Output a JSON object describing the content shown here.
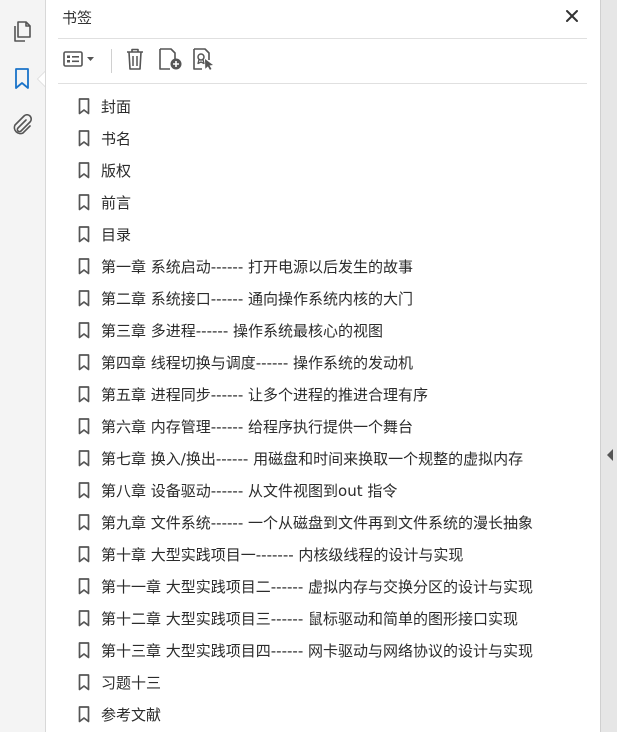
{
  "panel": {
    "title": "书签"
  },
  "icons": {
    "pages": "pages-icon",
    "bookmarks": "bookmark-icon",
    "attachments": "paperclip-icon",
    "close": "close-icon",
    "options": "options-menu-icon",
    "delete": "trash-icon",
    "new_bookmark": "new-bookmark-icon",
    "bookmark_from_selection": "bookmark-selection-icon"
  },
  "colors": {
    "accent": "#1a73c9",
    "icon": "#555555"
  },
  "bookmarks": [
    {
      "label": "封面"
    },
    {
      "label": "书名"
    },
    {
      "label": "版权"
    },
    {
      "label": "前言"
    },
    {
      "label": "目录"
    },
    {
      "label": "第一章 系统启动------ 打开电源以后发生的故事"
    },
    {
      "label": "第二章 系统接口------ 通向操作系统内核的大门"
    },
    {
      "label": "第三章 多进程------ 操作系统最核心的视图"
    },
    {
      "label": "第四章 线程切换与调度------ 操作系统的发动机"
    },
    {
      "label": "第五章 进程同步------ 让多个进程的推进合理有序"
    },
    {
      "label": "第六章 内存管理------ 给程序执行提供一个舞台"
    },
    {
      "label": "第七章 换入/换出------ 用磁盘和时间来换取一个规整的虚拟内存"
    },
    {
      "label": "第八章 设备驱动------ 从文件视图到out 指令"
    },
    {
      "label": "第九章 文件系统------ 一个从磁盘到文件再到文件系统的漫长抽象"
    },
    {
      "label": "第十章 大型实践项目一------- 内核级线程的设计与实现"
    },
    {
      "label": "第十一章 大型实践项目二------ 虚拟内存与交换分区的设计与实现"
    },
    {
      "label": "第十二章 大型实践项目三------ 鼠标驱动和简单的图形接口实现"
    },
    {
      "label": "第十三章 大型实践项目四------ 网卡驱动与网络协议的设计与实现"
    },
    {
      "label": "习题十三"
    },
    {
      "label": "参考文献"
    }
  ]
}
